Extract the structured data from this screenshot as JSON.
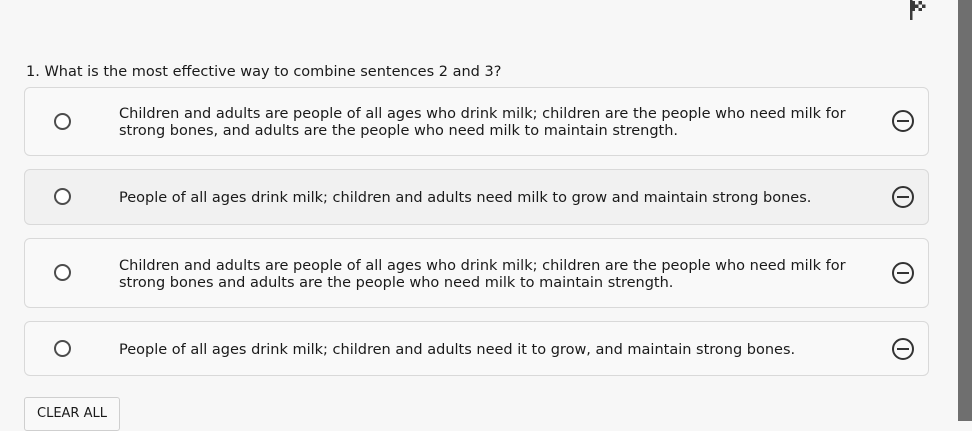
{
  "question": {
    "number": "1.",
    "text": "What is the most effective way to combine sentences 2 and 3?",
    "full": "1. What is the most effective way to combine sentences 2 and 3?"
  },
  "options": [
    {
      "text": "Children and adults are people of all ages who drink milk; children are the people who need milk for strong bones, and adults are the people who need milk to maintain strength.",
      "selected": false
    },
    {
      "text": "People of all ages drink milk; children and adults need milk to grow and maintain strong bones.",
      "selected": false
    },
    {
      "text": "Children and adults are people of all ages who drink milk; children are the people who need milk for strong bones and adults are the people who need milk to maintain strength.",
      "selected": false
    },
    {
      "text": "People of all ages drink milk; children and adults need it to grow, and maintain strong bones.",
      "selected": false
    }
  ],
  "clear_all_label": "CLEAR ALL",
  "icons": {
    "flag": "flag-icon",
    "radio": "radio-circle-icon",
    "eliminate": "eliminate-choice-icon"
  },
  "colors": {
    "page_background": "#f7f7f7",
    "option_border": "#d9d9d9",
    "scrollbar": "#6f6f6f",
    "icon_dark": "#333333"
  }
}
